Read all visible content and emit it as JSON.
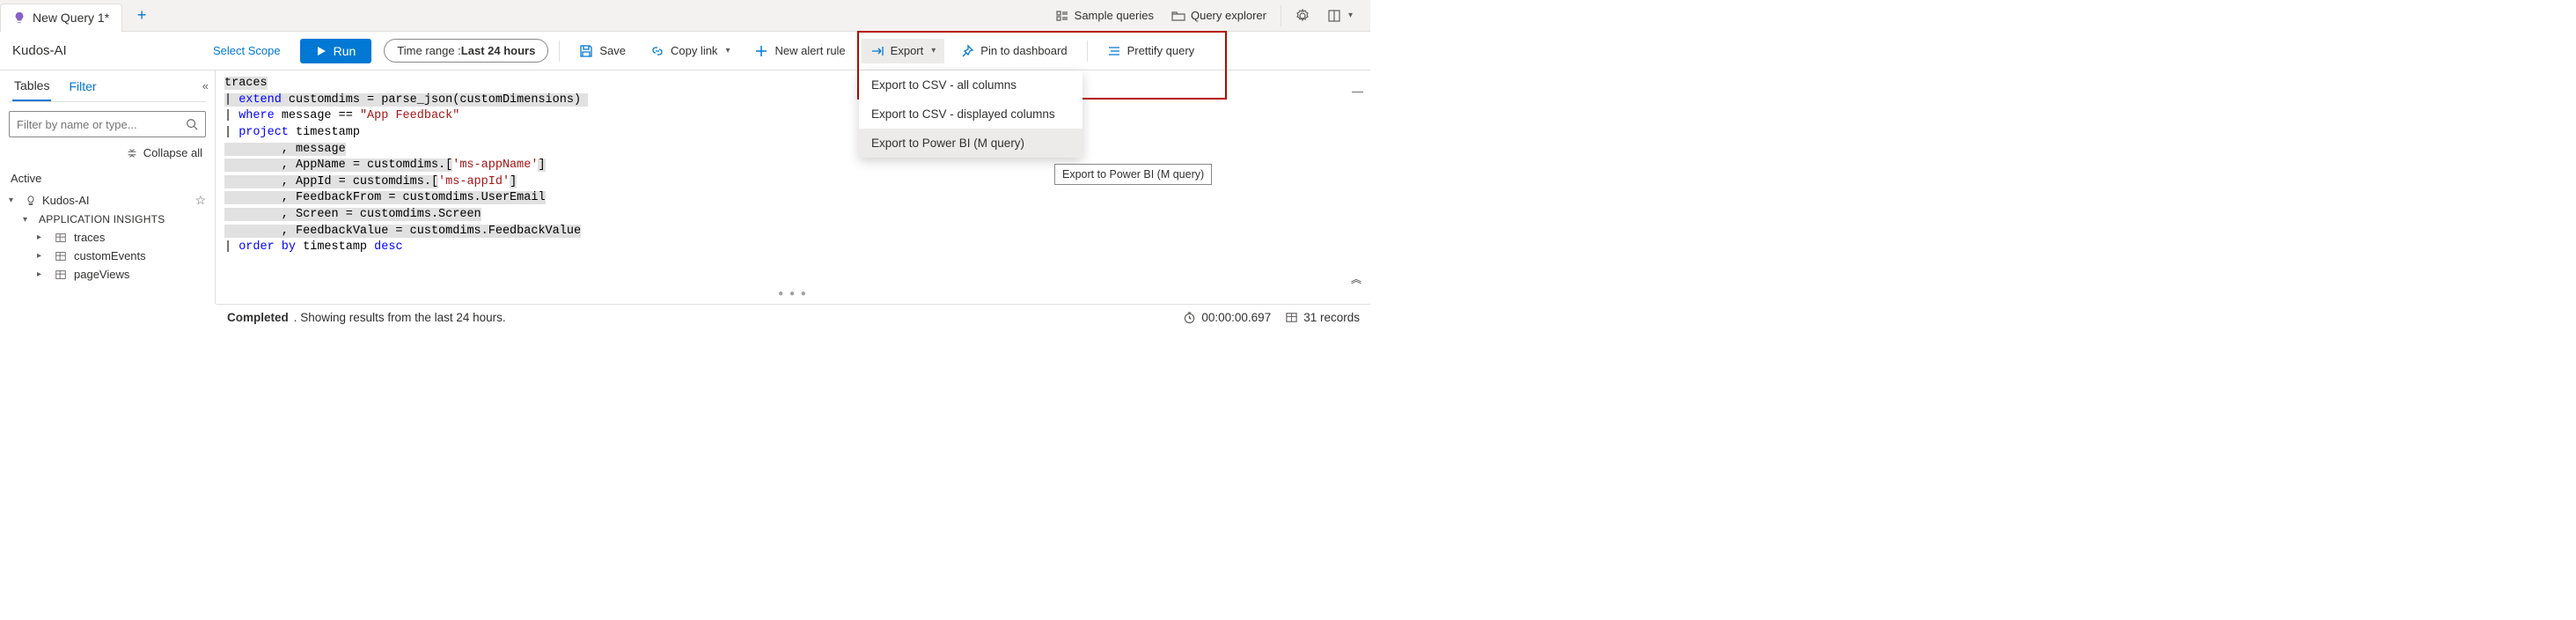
{
  "tab": {
    "title": "New Query 1*"
  },
  "tab_right": {
    "sample_queries": "Sample queries",
    "query_explorer": "Query explorer"
  },
  "toolbar": {
    "app_title": "Kudos-AI",
    "select_scope": "Select Scope",
    "run": "Run",
    "time_label": "Time range : ",
    "time_value": "Last 24 hours",
    "save": "Save",
    "copy_link": "Copy link",
    "new_alert": "New alert rule",
    "export": "Export",
    "pin": "Pin to dashboard",
    "prettify": "Prettify query"
  },
  "sidebar": {
    "tabs": {
      "tables": "Tables",
      "filter": "Filter"
    },
    "filter_placeholder": "Filter by name or type...",
    "collapse_all": "Collapse all",
    "heading": "Active",
    "root": "Kudos-AI",
    "group": "APPLICATION INSIGHTS",
    "leaves": [
      "traces",
      "customEvents",
      "pageViews"
    ]
  },
  "dropdown": {
    "items": [
      "Export to CSV - all columns",
      "Export to CSV - displayed columns",
      "Export to Power BI (M query)"
    ],
    "tooltip": "Export to Power BI (M query)"
  },
  "query": {
    "l1": "traces",
    "l2a": "| ",
    "l2b": "extend",
    "l2c": " customdims = parse_json(customDimensions) ",
    "l3a": "| ",
    "l3b": "where",
    "l3c": " message == ",
    "l3d": "\"App Feedback\"",
    "l4a": "| ",
    "l4b": "project",
    "l4c": " timestamp",
    "l5": "        , message",
    "l6a": "        , AppName = customdims.[",
    "l6b": "'ms-appName'",
    "l6c": "]",
    "l7a": "        , AppId = customdims.[",
    "l7b": "'ms-appId'",
    "l7c": "]",
    "l8": "        , FeedbackFrom = customdims.UserEmail",
    "l9": "        , Screen = customdims.Screen",
    "l10": "        , FeedbackValue = customdims.FeedbackValue",
    "l11a": "| ",
    "l11b": "order by",
    "l11c": " timestamp ",
    "l11d": "desc"
  },
  "status": {
    "completed": "Completed",
    "msg": ". Showing results from the last 24 hours.",
    "time": "00:00:00.697",
    "records": "31 records"
  }
}
